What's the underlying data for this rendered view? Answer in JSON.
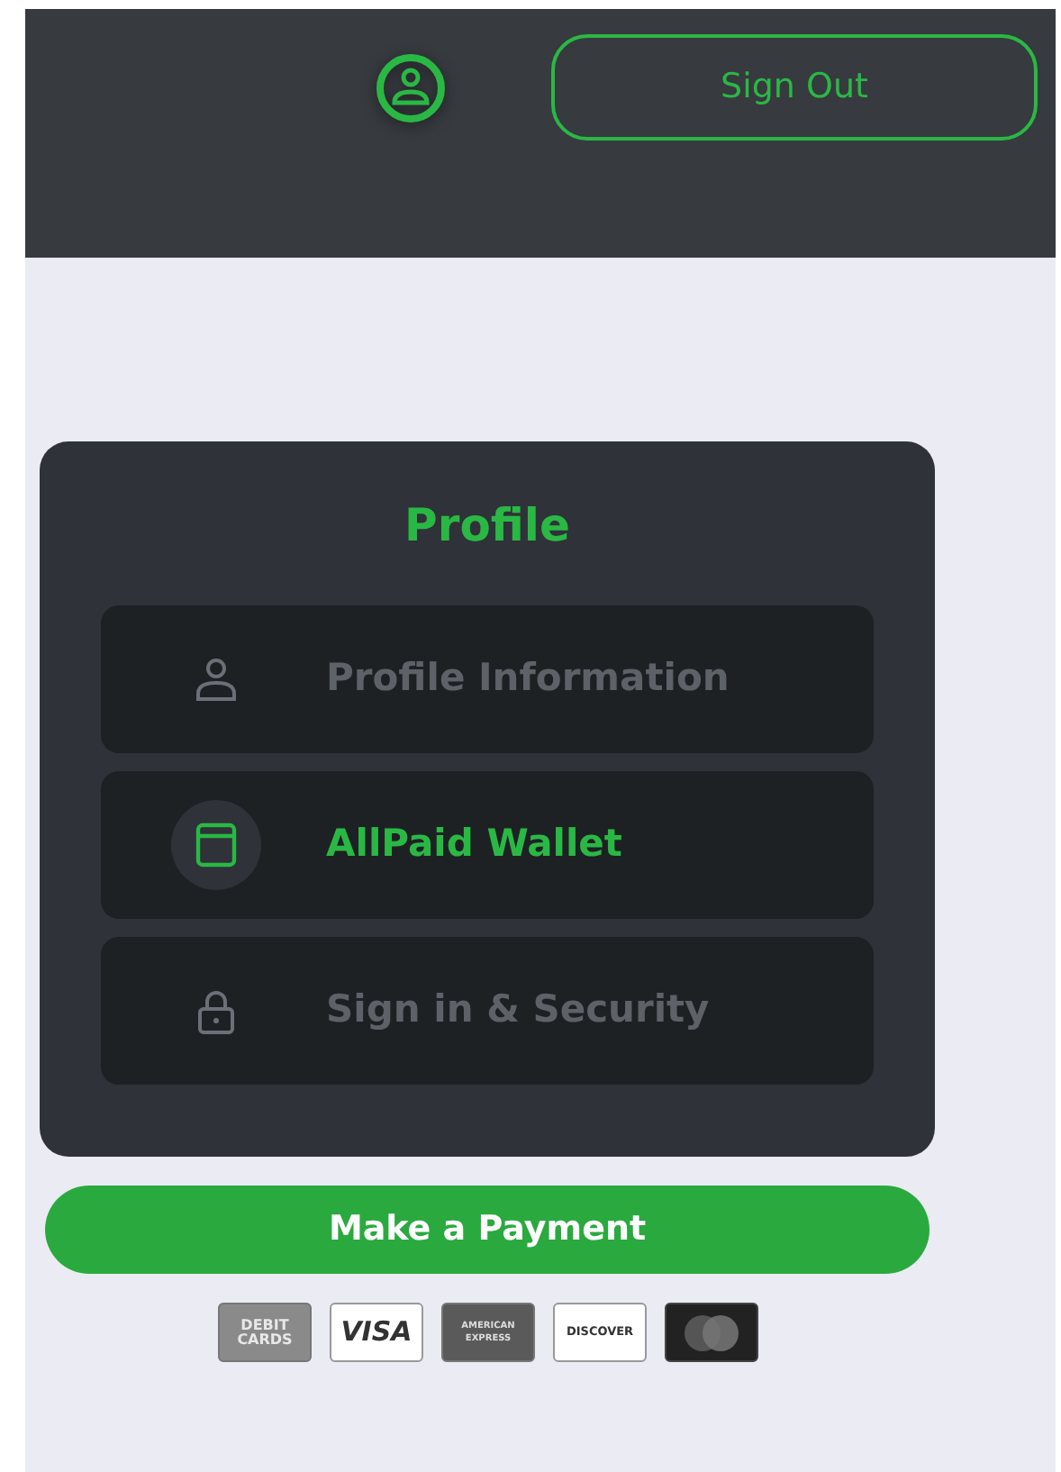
{
  "header": {
    "sign_out_button": "Sign Out"
  },
  "profile_menu": {
    "title": "Profile",
    "items": [
      {
        "label": "Profile Information",
        "kind": "person",
        "selected": false
      },
      {
        "label": "AllPaid Wallet",
        "kind": "wallet",
        "selected": true
      },
      {
        "label": "Sign in & Security",
        "kind": "lock",
        "selected": false
      }
    ]
  },
  "payment_button": "Make a Payment",
  "payment_methods": [
    {
      "kind": "debit",
      "lines": [
        "DEBIT",
        "CARDS"
      ]
    },
    {
      "kind": "visa",
      "lines": [
        "VISA"
      ]
    },
    {
      "kind": "amex",
      "lines": [
        "AMERICAN",
        "EXPRESS"
      ]
    },
    {
      "kind": "discover",
      "lines": [
        "DISCOVER"
      ]
    },
    {
      "kind": "mastercard"
    }
  ]
}
